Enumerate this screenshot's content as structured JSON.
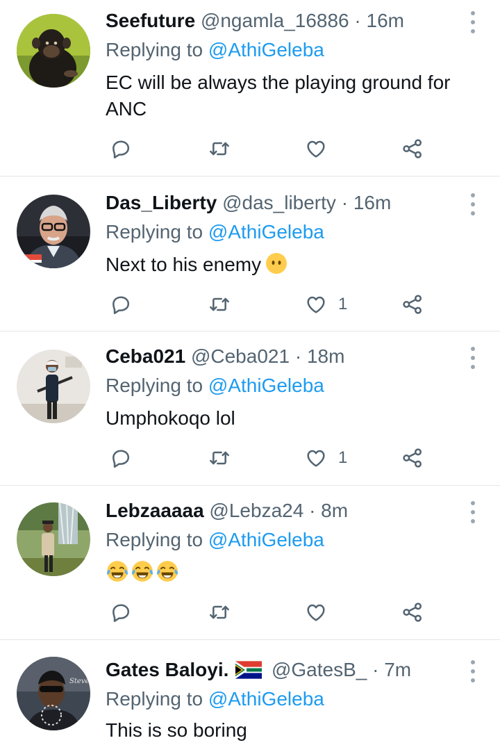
{
  "replying_label": "Replying to",
  "tweets": [
    {
      "name": "Seefuture",
      "handle": "@ngamla_16886",
      "time": "16m",
      "replying_to": "@AthiGeleba",
      "text_line1": "EC will be always the playing ground for",
      "text_line2": "ANC",
      "likes": ""
    },
    {
      "name": "Das_Liberty",
      "handle": "@das_liberty",
      "time": "16m",
      "replying_to": "@AthiGeleba",
      "text": "Next to his enemy",
      "emoji": "face-without-mouth",
      "likes": "1"
    },
    {
      "name": "Ceba021",
      "handle": "@Ceba021",
      "time": "18m",
      "replying_to": "@AthiGeleba",
      "text": "Umphokoqo lol",
      "likes": "1"
    },
    {
      "name": "Lebzaaaaa",
      "handle": "@Lebza24",
      "time": "8m",
      "replying_to": "@AthiGeleba",
      "emojis": [
        "face-with-tears-of-joy",
        "face-with-tears-of-joy",
        "face-with-tears-of-joy"
      ],
      "likes": ""
    },
    {
      "name": "Gates Baloyi.",
      "flag": "south-africa-flag",
      "handle": "@GatesB_",
      "time": "7m",
      "replying_to": "@AthiGeleba",
      "text": "This is so boring"
    }
  ],
  "separator": "·",
  "colors": {
    "mention": "#1d9bf0",
    "secondary": "#536471",
    "divider": "#e3e6e8"
  }
}
